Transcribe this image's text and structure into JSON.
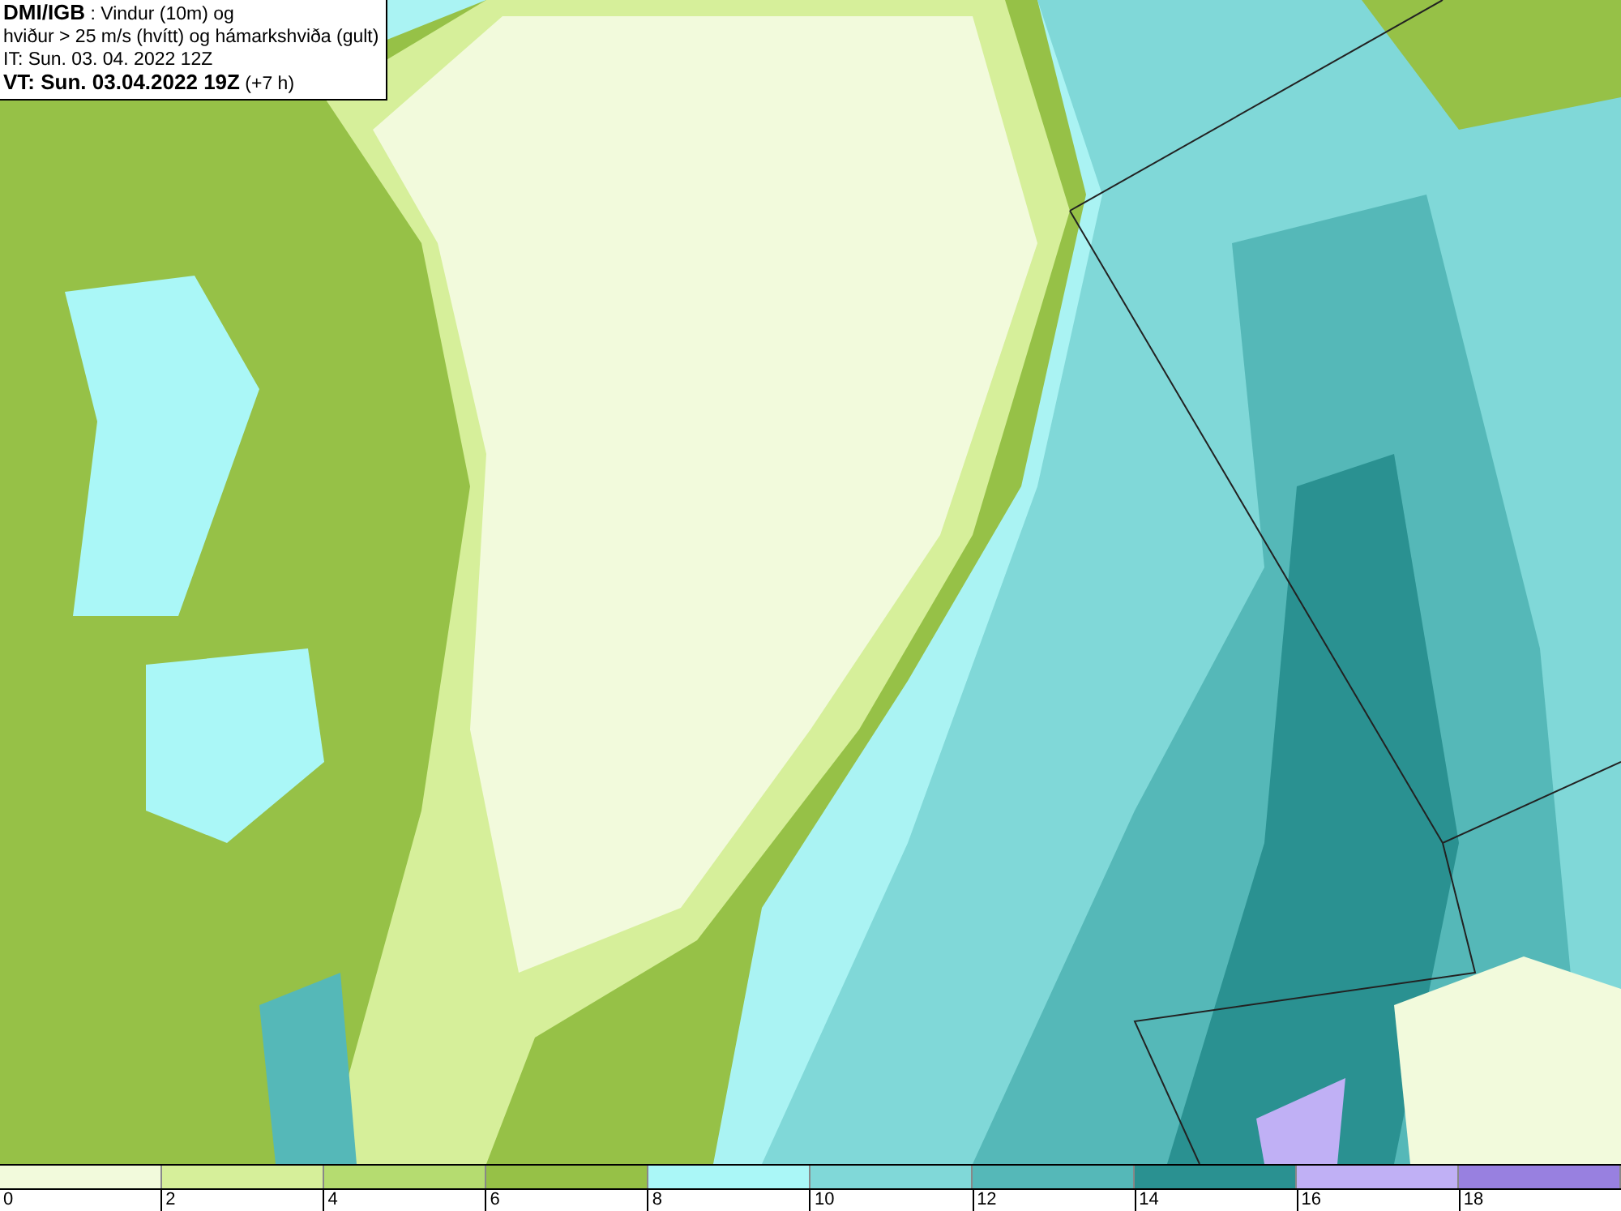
{
  "info_box": {
    "lines": [
      "**DMI/IGB** : Vindur (10m) og",
      "hviður > 25 m/s (hvítt) og hámarkshviða (gult)",
      "IT: Sun. 03. 04. 2022 12Z",
      "**VT: Sun. 03.04.2022 19Z** (+7 h)"
    ]
  },
  "legend": {
    "swatches": [
      {
        "color": "#f2fadc"
      },
      {
        "color": "#d6ef9a"
      },
      {
        "color": "#b5dc70"
      },
      {
        "color": "#96c147"
      },
      {
        "color": "#aaf7f7"
      },
      {
        "color": "#80d8d8"
      },
      {
        "color": "#55b8b8"
      },
      {
        "color": "#2a9191"
      },
      {
        "color": "#c0b0f5"
      },
      {
        "color": "#9880e0"
      }
    ],
    "ticks": [
      "0",
      "2",
      "4",
      "6",
      "8",
      "10",
      "12",
      "14",
      "16",
      "18"
    ]
  }
}
